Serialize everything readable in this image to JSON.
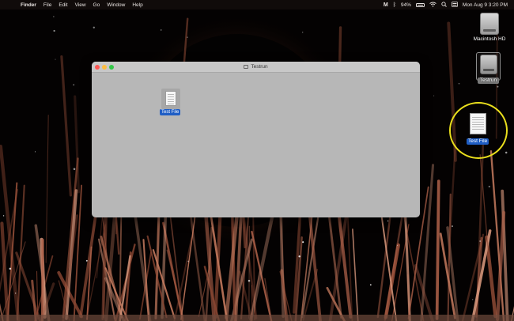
{
  "menubar": {
    "apple_icon": "apple-logo-icon",
    "items": [
      "Finder",
      "File",
      "Edit",
      "View",
      "Go",
      "Window",
      "Help"
    ],
    "status": {
      "app_glyph": "M",
      "battery_percent": "94%",
      "datetime": "Mon Aug 9  3:20 PM"
    }
  },
  "window": {
    "title": "Testrun",
    "file_label": "Test File",
    "colors": {
      "body": "#b7b7b7",
      "titlebar": "#c8c8c8"
    }
  },
  "desktop": {
    "drive_label": "Macintosh HD",
    "mounted_label": "Testrun",
    "file_label": "Test File",
    "colors": {
      "selection": "#1f5ec5",
      "highlight_ring": "#e9de1d"
    }
  }
}
